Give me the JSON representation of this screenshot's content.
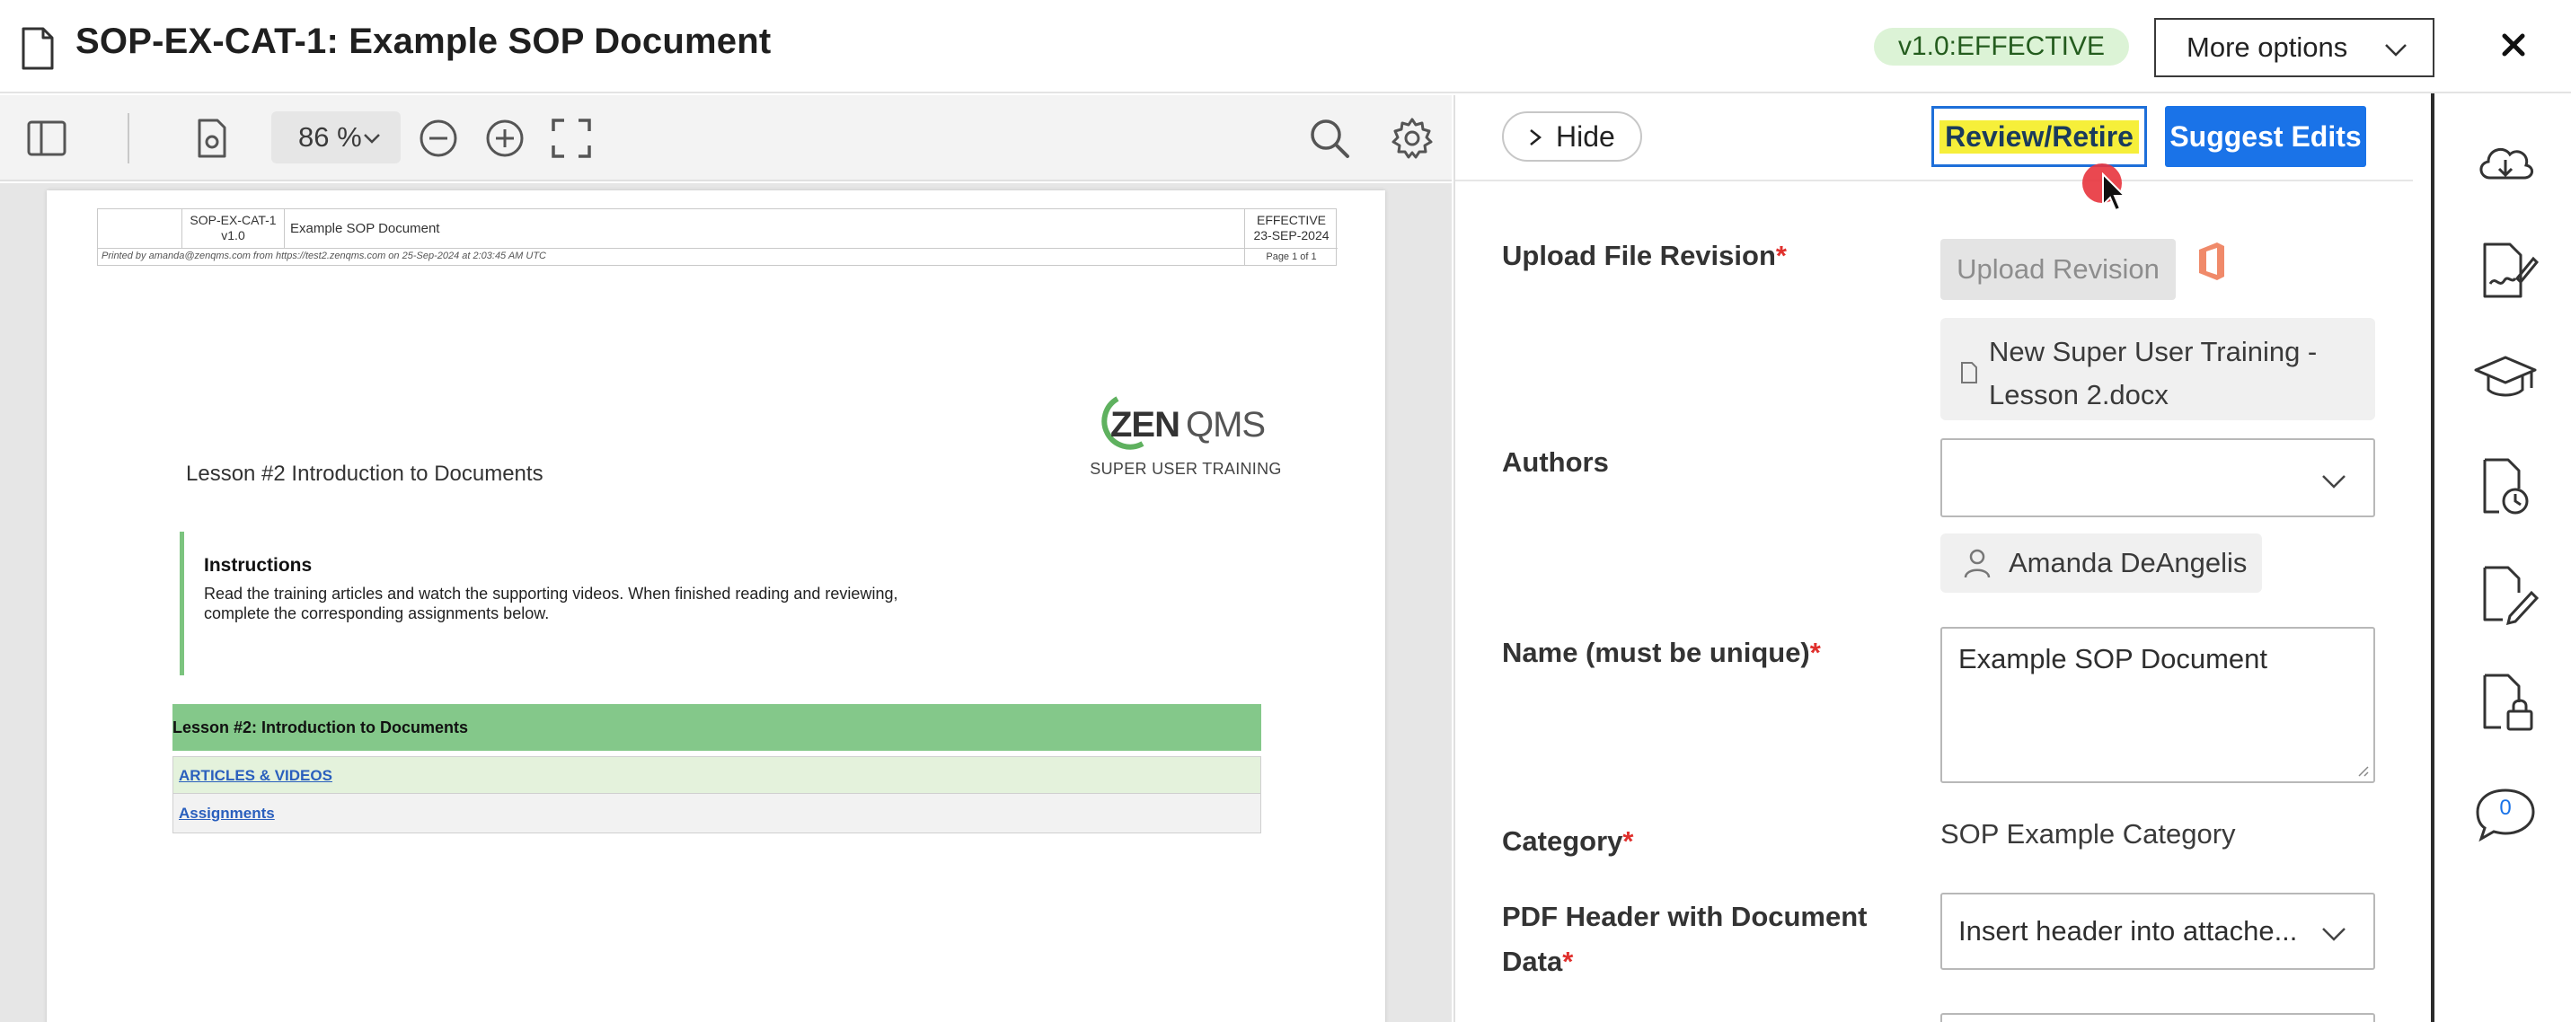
{
  "header": {
    "title": "SOP-EX-CAT-1: Example SOP Document",
    "status": "v1.0:EFFECTIVE",
    "more_options": "More options"
  },
  "viewer_toolbar": {
    "zoom": "86 %"
  },
  "document": {
    "header_table": {
      "doc_id": "SOP-EX-CAT-1",
      "version": "v1.0",
      "doc_name": "Example SOP Document",
      "status": "EFFECTIVE",
      "date": "23-SEP-2024",
      "printed_line": "Printed by amanda@zenqms.com from https://test2.zenqms.com on 25-Sep-2024 at 2:03:45 AM UTC",
      "page": "Page 1 of 1"
    },
    "logo_text": "ZENQMS",
    "logo_tagline": "SUPER USER TRAINING",
    "lesson_title": "Lesson #2 Introduction to Documents",
    "instructions_heading": "Instructions",
    "instructions_text": "Read the training articles and watch the supporting videos. When finished reading and reviewing, complete the corresponding assignments below.",
    "green_bar": "Lesson #2: Introduction to Documents",
    "link_articles": "ARTICLES & VIDEOS",
    "link_assignments": "Assignments"
  },
  "panel": {
    "hide_label": "Hide",
    "review_retire": "Review/Retire",
    "suggest_edits": "Suggest Edits",
    "fields": {
      "upload_file_revision": "Upload File Revision",
      "upload_revision_btn": "Upload Revision",
      "file_name_line1": "New Super User Training -",
      "file_name_line2": "Lesson 2.docx",
      "authors": "Authors",
      "author_name": "Amanda DeAngelis",
      "name_label": "Name (must be unique)",
      "name_value": "Example SOP Document",
      "category_label": "Category",
      "category_value": "SOP Example Category",
      "pdf_header_line1": "PDF Header with Document",
      "pdf_header_line2": "Data",
      "pdf_header_value": "Insert header into attache..."
    }
  },
  "rail": {
    "comment_count": "0"
  },
  "colors": {
    "accent": "#1a73e8",
    "effective_bg": "#dcf3d6",
    "required": "#e0302d",
    "highlight": "#f6ef3a"
  }
}
